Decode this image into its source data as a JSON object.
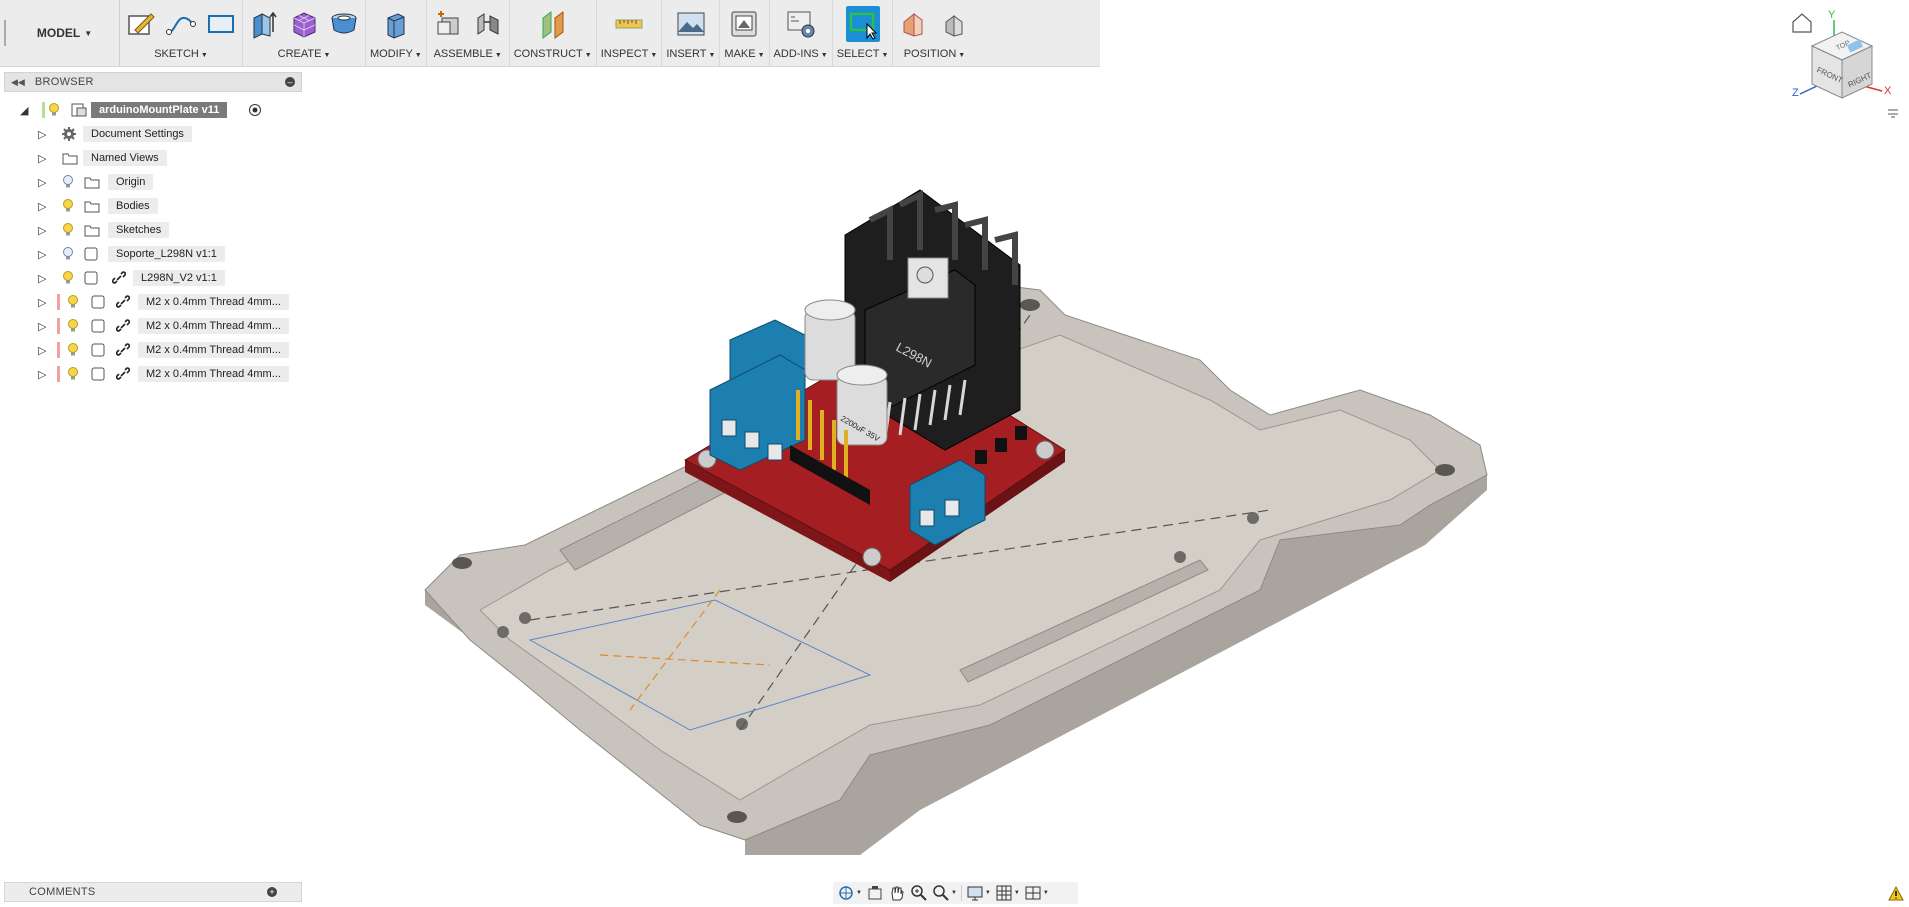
{
  "workspace": {
    "label": "MODEL"
  },
  "toolbar": {
    "groups": [
      {
        "label": "SKETCH"
      },
      {
        "label": "CREATE"
      },
      {
        "label": "MODIFY"
      },
      {
        "label": "ASSEMBLE"
      },
      {
        "label": "CONSTRUCT"
      },
      {
        "label": "INSPECT"
      },
      {
        "label": "INSERT"
      },
      {
        "label": "MAKE"
      },
      {
        "label": "ADD-INS"
      },
      {
        "label": "SELECT"
      },
      {
        "label": "POSITION"
      }
    ]
  },
  "browser": {
    "title": "BROWSER",
    "root": "arduinoMountPlate v11",
    "items": [
      {
        "label": "Document Settings",
        "icon": "gear-icon"
      },
      {
        "label": "Named Views",
        "icon": "folder-icon"
      },
      {
        "label": "Origin",
        "icon": "folder-icon"
      },
      {
        "label": "Bodies",
        "icon": "folder-icon"
      },
      {
        "label": "Sketches",
        "icon": "folder-icon"
      },
      {
        "label": "Soporte_L298N v1:1",
        "icon": "component-icon"
      },
      {
        "label": "L298N_V2 v1:1",
        "icon": "linked-component-icon"
      },
      {
        "label": "M2 x 0.4mm Thread 4mm...",
        "icon": "linked-component-icon"
      },
      {
        "label": "M2 x 0.4mm Thread 4mm...",
        "icon": "linked-component-icon"
      },
      {
        "label": "M2 x 0.4mm Thread 4mm...",
        "icon": "linked-component-icon"
      },
      {
        "label": "M2 x 0.4mm Thread 4mm...",
        "icon": "linked-component-icon"
      }
    ]
  },
  "comments": {
    "title": "COMMENTS"
  },
  "viewcube": {
    "top": "TOP",
    "front": "FRONT",
    "right": "RIGHT",
    "axis_x": "X",
    "axis_y": "Y",
    "axis_z": "Z"
  },
  "model": {
    "chip_label": "L298N",
    "cap_label": "2200uF 35V"
  },
  "colors": {
    "accent": "#1a8fd6",
    "plate": "#c8c4bd",
    "pcb": "#a51e22",
    "terminal": "#1d7fb0",
    "heatsink": "#1e1e1e"
  }
}
